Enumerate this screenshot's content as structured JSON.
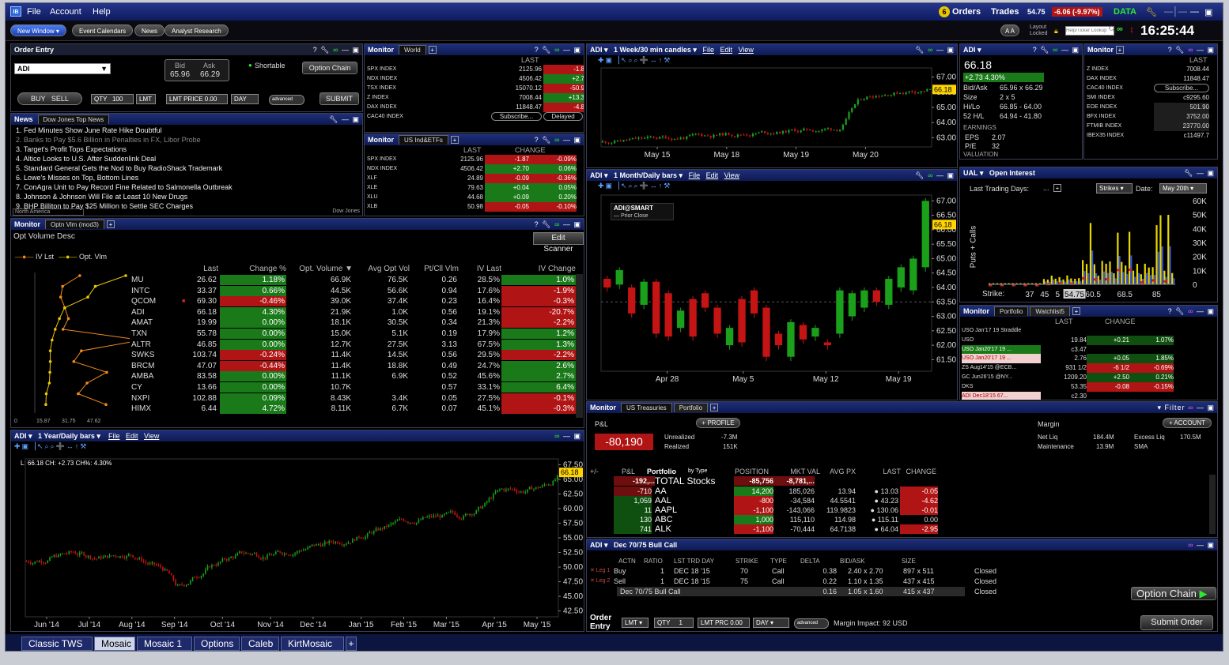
{
  "menubar": {
    "logo": "IB",
    "items": [
      "File",
      "Account",
      "Help"
    ],
    "orders_count": "6",
    "orders": "Orders",
    "trades": "Trades",
    "pnl_value": "54.75",
    "pnl_change": "-6.06 (-9.97%)",
    "data_label": "DATA"
  },
  "toolbar": {
    "buttons": [
      "New Window",
      "Event Calendars",
      "News",
      "Analyst Research"
    ],
    "aa": "A A",
    "layout_locked": "Layout Locked",
    "lookup_placeholder": "Help/Ticker Lookup",
    "clock": "16:25:44"
  },
  "order_entry": {
    "title": "Order Entry",
    "symbol": "ADI",
    "bid_label": "Bid",
    "bid": "65.96",
    "ask_label": "Ask",
    "ask": "66.29",
    "shortable": "Shortable",
    "option_chain": "Option Chain",
    "buy": "BUY",
    "sell": "SELL",
    "qty_label": "QTY",
    "qty": "100",
    "type": "LMT",
    "lmt_price": "LMT PRICE 0.00",
    "tif": "DAY",
    "advanced": "advanced",
    "submit": "SUBMIT"
  },
  "news": {
    "title": "News",
    "tab": "Dow Jones Top News",
    "items": [
      "1.  Fed Minutes Show June Rate Hike Doubtful",
      "2.  Banks to Pay $5.6 Billion in Penalties in FX, Libor Probe",
      "3.  Target's Profit Tops Expectations",
      "4.  Altice Looks to U.S. After Suddenlink  Deal",
      "5.  Standard General Gets the Nod to Buy RadioShack  Trademark",
      "6.  Lowe's  Misses on Top, Bottom Lines",
      "7.  ConAgra  Unit to Pay Record Fine Related to Salmonella Outbreak",
      "8.  Johnson & Johnson  Will File at Least 10 New Drugs",
      "9.  BHP Billiton  to Pay $25 Million to Settle SEC Charges"
    ],
    "region": "North America",
    "source": "Dow Jones"
  },
  "monitor_world": {
    "title": "Monitor",
    "tab": "World",
    "col_last": "LAST",
    "rows": [
      {
        "sym": "SPX INDEX",
        "last": "2125.96",
        "chg": "-1.8",
        "c": "red"
      },
      {
        "sym": "NDX INDEX",
        "last": "4506.42",
        "chg": "+2.7",
        "c": "green"
      },
      {
        "sym": "TSX INDEX",
        "last": "15070.12",
        "chg": "-50.9",
        "c": "red"
      },
      {
        "sym": "Z INDEX",
        "last": "7008.44",
        "chg": "+13.3",
        "c": "green"
      },
      {
        "sym": "DAX INDEX",
        "last": "11848.47",
        "chg": "-4.8",
        "c": "red"
      },
      {
        "sym": "CAC40 INDEX",
        "last": "Subscribe...",
        "chg": "Delayed",
        "c": "btn"
      }
    ]
  },
  "monitor_us": {
    "title": "Monitor",
    "tab": "US Ind&ETFs",
    "col_last": "LAST",
    "col_change": "CHANGE",
    "rows": [
      {
        "sym": "SPX INDEX",
        "last": "2125.96",
        "chg": "-1.87",
        "pct": "-0.09%",
        "c": "red"
      },
      {
        "sym": "NDX INDEX",
        "last": "4506.42",
        "chg": "+2.70",
        "pct": "0.06%",
        "c": "green"
      },
      {
        "sym": "XLF",
        "last": "24.89",
        "chg": "-0.09",
        "pct": "-0.36%",
        "c": "red"
      },
      {
        "sym": "XLE",
        "last": "79.63",
        "chg": "+0.04",
        "pct": "0.05%",
        "c": "green"
      },
      {
        "sym": "XLU",
        "last": "44.68",
        "chg": "+0.09",
        "pct": "0.20%",
        "c": "green"
      },
      {
        "sym": "XLB",
        "last": "50.98",
        "chg": "-0.05",
        "pct": "-0.10%",
        "c": "red"
      }
    ]
  },
  "scanner": {
    "title": "Monitor",
    "tab": "Optn Vlm (mod3)",
    "subtitle": "Opt Volume Desc",
    "edit_scanner": "Edit Scanner",
    "legend_a": "IV Lst",
    "legend_b": "Opt. Vlm",
    "axis_labels": [
      "0",
      "15.87",
      "31.75",
      "47.62"
    ],
    "columns": [
      "Last",
      "Change %",
      "Opt. Volume",
      "Avg Opt Vol",
      "Pt/Cll Vlm",
      "IV Last",
      "IV Change"
    ],
    "rows": [
      {
        "sym": "MU",
        "last": "26.62",
        "chg": "1.18%",
        "vol": "66.9K",
        "avg": "76.5K",
        "pc": "0.26",
        "iv": "28.5%",
        "ivc": "1.0%",
        "cc": "green",
        "ic": "green"
      },
      {
        "sym": "INTC",
        "last": "33.37",
        "chg": "0.66%",
        "vol": "44.5K",
        "avg": "56.6K",
        "pc": "0.94",
        "iv": "17.6%",
        "ivc": "-1.9%",
        "cc": "green",
        "ic": "red"
      },
      {
        "sym": "QCOM",
        "last": "69.30",
        "chg": "-0.46%",
        "vol": "39.0K",
        "avg": "37.4K",
        "pc": "0.23",
        "iv": "16.4%",
        "ivc": "-0.3%",
        "cc": "red",
        "ic": "red"
      },
      {
        "sym": "ADI",
        "last": "66.18",
        "chg": "4.30%",
        "vol": "21.9K",
        "avg": "1.0K",
        "pc": "0.56",
        "iv": "19.1%",
        "ivc": "-20.7%",
        "cc": "green",
        "ic": "red"
      },
      {
        "sym": "AMAT",
        "last": "19.99",
        "chg": "0.00%",
        "vol": "18.1K",
        "avg": "30.5K",
        "pc": "0.34",
        "iv": "21.3%",
        "ivc": "-2.2%",
        "cc": "green",
        "ic": "red"
      },
      {
        "sym": "TXN",
        "last": "55.78",
        "chg": "0.00%",
        "vol": "15.0K",
        "avg": "5.1K",
        "pc": "0.19",
        "iv": "17.9%",
        "ivc": "1.2%",
        "cc": "green",
        "ic": "green"
      },
      {
        "sym": "ALTR",
        "last": "46.85",
        "chg": "0.00%",
        "vol": "12.7K",
        "avg": "27.5K",
        "pc": "3.13",
        "iv": "67.5%",
        "ivc": "1.3%",
        "cc": "green",
        "ic": "green"
      },
      {
        "sym": "SWKS",
        "last": "103.74",
        "chg": "-0.24%",
        "vol": "11.4K",
        "avg": "14.5K",
        "pc": "0.56",
        "iv": "29.5%",
        "ivc": "-2.2%",
        "cc": "red",
        "ic": "red"
      },
      {
        "sym": "BRCM",
        "last": "47.07",
        "chg": "-0.44%",
        "vol": "11.4K",
        "avg": "18.8K",
        "pc": "0.49",
        "iv": "24.7%",
        "ivc": "2.6%",
        "cc": "red",
        "ic": "green"
      },
      {
        "sym": "AMBA",
        "last": "83.58",
        "chg": "0.00%",
        "vol": "11.1K",
        "avg": "6.9K",
        "pc": "0.52",
        "iv": "45.6%",
        "ivc": "2.7%",
        "cc": "green",
        "ic": "green"
      },
      {
        "sym": "CY",
        "last": "13.66",
        "chg": "0.00%",
        "vol": "10.7K",
        "avg": "",
        "pc": "0.57",
        "iv": "33.1%",
        "ivc": "6.4%",
        "cc": "green",
        "ic": "green"
      },
      {
        "sym": "NXPI",
        "last": "102.88",
        "chg": "0.09%",
        "vol": "8.43K",
        "avg": "3.4K",
        "pc": "0.05",
        "iv": "27.5%",
        "ivc": "-0.1%",
        "cc": "green",
        "ic": "red"
      },
      {
        "sym": "HIMX",
        "last": "6.44",
        "chg": "4.72%",
        "vol": "8.11K",
        "avg": "6.7K",
        "pc": "0.07",
        "iv": "45.1%",
        "ivc": "-0.3%",
        "cc": "green",
        "ic": "red"
      }
    ]
  },
  "chart_week": {
    "title": "ADI",
    "period": "1 Week/30 min candles",
    "menu": [
      "File",
      "Edit",
      "View"
    ],
    "y_ticks": [
      "67.00",
      "66.00",
      "65.00",
      "64.00",
      "63.00"
    ],
    "x_ticks": [
      "May 15",
      "May 18",
      "May 19",
      "May 20"
    ],
    "last": "66.18"
  },
  "chart_month": {
    "title": "ADI",
    "period": "1 Month/Daily bars",
    "menu": [
      "File",
      "Edit",
      "View"
    ],
    "legend_title": "ADI@SMART",
    "legend_sub": "Prior Close",
    "y_ticks": [
      "67.00",
      "66.50",
      "66.00",
      "65.50",
      "65.00",
      "64.50",
      "64.00",
      "63.50",
      "63.00",
      "62.50",
      "62.00",
      "61.50"
    ],
    "x_ticks": [
      "Apr 28",
      "May 5",
      "May 12",
      "May 19"
    ],
    "last": "66.18"
  },
  "chart_year": {
    "title": "ADI",
    "period": "1 Year/Daily bars",
    "menu": [
      "File",
      "Edit",
      "View"
    ],
    "info": "L: 66.18 CH: +2.73 CH%: 4.30%",
    "y_ticks": [
      "67.50",
      "65.00",
      "62.50",
      "60.00",
      "57.50",
      "55.00",
      "52.50",
      "50.00",
      "47.50",
      "45.00",
      "42.50"
    ],
    "x_ticks": [
      "Jun '14",
      "Jul '14",
      "Aug '14",
      "Sep '14",
      "Oct '14",
      "Nov '14",
      "Dec '14",
      "Jan '15",
      "Feb '15",
      "Mar '15",
      "Apr '15",
      "May '15"
    ],
    "last": "66.18"
  },
  "quote": {
    "title": "ADI",
    "price": "66.18",
    "change": "+2.73  4.30%",
    "fields": [
      {
        "k": "Bid/Ask",
        "v": "65.96 x 66.29"
      },
      {
        "k": "Size",
        "v": "2 x 5"
      },
      {
        "k": "Hi/Lo",
        "v": "66.85 - 64.00"
      },
      {
        "k": "52 H/L",
        "v": "64.94 - 41.80"
      }
    ],
    "earnings": "EARNINGS",
    "eps_k": "EPS",
    "eps": "2.07",
    "pe_k": "P/E",
    "pe": "32",
    "valuation": "VALUATION"
  },
  "monitor_right": {
    "title": "Monitor",
    "col_last": "LAST",
    "rows": [
      {
        "sym": "Z INDEX",
        "last": "7008.44"
      },
      {
        "sym": "DAX INDEX",
        "last": "11848.47"
      },
      {
        "sym": "CAC40 INDEX",
        "last": "Subscribe..."
      },
      {
        "sym": "SMI INDEX",
        "last": "c9295.60"
      },
      {
        "sym": "EOE INDEX",
        "last": "501.90"
      },
      {
        "sym": "BFX INDEX",
        "last": "3752.00"
      },
      {
        "sym": "FTMIB INDEX",
        "last": "23770.00"
      },
      {
        "sym": "IBEX35 INDEX",
        "last": "c11497.7"
      }
    ]
  },
  "open_interest": {
    "title": "UAL",
    "subtitle": "Open Interest",
    "last_trading_days": "Last Trading Days:",
    "strikes": "Strikes",
    "date_label": "Date:",
    "date": "May 20th",
    "y_label": "Puts + Calls",
    "strike_label": "Strike:",
    "y_ticks": [
      "60K",
      "50K",
      "40K",
      "30K",
      "20K",
      "10K",
      "0"
    ]
  },
  "watchlist": {
    "title": "Monitor",
    "tabs": [
      "Portfolio",
      "Watchlist5"
    ],
    "col_last": "LAST",
    "col_change": "CHANGE",
    "rows": [
      {
        "sym": "USO Jan'17 19 Straddle",
        "last": "",
        "chg": "",
        "pct": "",
        "c": ""
      },
      {
        "sym": "USO",
        "last": "19.84",
        "chg": "+0.21",
        "pct": "1.07%",
        "c": "green"
      },
      {
        "sym": "USO Jan20'17 19 ...",
        "last": "c3.47",
        "chg": "",
        "pct": "",
        "c": ""
      },
      {
        "sym": "USO Jan20'17 19 ...",
        "last": "2.76",
        "chg": "+0.05",
        "pct": "1.85%",
        "c": "green"
      },
      {
        "sym": "ZS Aug14'15 @ECB...",
        "last": "931 1/2",
        "chg": "-6 1/2",
        "pct": "-0.69%",
        "c": "red"
      },
      {
        "sym": "GC Jun26'15 @NY...",
        "last": "1209.20",
        "chg": "+2.50",
        "pct": "0.21%",
        "c": "green"
      },
      {
        "sym": "DKS",
        "last": "53.35",
        "chg": "-0.08",
        "pct": "-0.15%",
        "c": "red"
      },
      {
        "sym": "ADI Dec18'15 67...",
        "last": "c2.30",
        "chg": "",
        "pct": "",
        "c": ""
      }
    ]
  },
  "portfolio": {
    "title": "Monitor",
    "tabs": [
      "US Treasuries",
      "Portfolio"
    ],
    "filter": "Filter",
    "pnl_label": "P&L",
    "profile": "PROFILE",
    "pnl_value": "-80,190",
    "unrealized_k": "Unrealized",
    "unrealized": "-7.3M",
    "realized_k": "Realized",
    "realized": "151K",
    "margin_label": "Margin",
    "account": "ACCOUNT",
    "netliq_k": "Net Liq",
    "netliq": "184.4M",
    "excessliq_k": "Excess Liq",
    "excessliq": "170.5M",
    "maint_k": "Maintenance",
    "maint": "13.9M",
    "sma_k": "SMA",
    "columns": [
      "+/-",
      "P&L",
      "Portfolio",
      "by Type",
      "POSITION",
      "MKT VAL",
      "AVG PX",
      "LAST",
      "CHANGE"
    ],
    "total": {
      "pnl": "-192,...",
      "name": "TOTAL Stocks",
      "pos": "-85,756",
      "mkt": "-8,781,..."
    },
    "rows": [
      {
        "pnl": "-710",
        "sym": "AA",
        "pos": "14,200",
        "mkt": "185,026",
        "avg": "13.94",
        "last": "13.03",
        "chg": "-0.05",
        "pc": "red"
      },
      {
        "pnl": "1,059",
        "sym": "AAL",
        "pos": "-800",
        "mkt": "-34,584",
        "avg": "44.5541",
        "last": "43.23",
        "chg": "-4.62",
        "pc": "red"
      },
      {
        "pnl": "11",
        "sym": "AAPL",
        "pos": "-1,100",
        "mkt": "-143,066",
        "avg": "119.9823",
        "last": "130.06",
        "chg": "-0.01",
        "pc": "red"
      },
      {
        "pnl": "130",
        "sym": "ABC",
        "pos": "1,000",
        "mkt": "115,110",
        "avg": "114.98",
        "last": "115.11",
        "chg": "0.00",
        "pc": ""
      },
      {
        "pnl": "741",
        "sym": "ALK",
        "pos": "-1,100",
        "mkt": "-70,444",
        "avg": "64.7138",
        "last": "64.04",
        "chg": "-2.95",
        "pc": "red"
      }
    ]
  },
  "combo": {
    "title": "ADI",
    "subtitle": "Dec 70/75 Bull Call",
    "columns": [
      "ACTN",
      "RATIO",
      "LST TRD DAY",
      "STRIKE",
      "TYPE",
      "DELTA",
      "BID/ASK",
      "SIZE"
    ],
    "rows": [
      {
        "leg": "Leg 1",
        "actn": "Buy",
        "ratio": "1",
        "day": "DEC 18 '15",
        "strike": "70",
        "type": "Call",
        "delta": "0.38",
        "bidask": "2.40 x 2.70",
        "size": "897 x 511",
        "status": "Closed"
      },
      {
        "leg": "Leg 2",
        "actn": "Sell",
        "ratio": "1",
        "day": "DEC 18 '15",
        "strike": "75",
        "type": "Call",
        "delta": "0.22",
        "bidask": "1.10 x 1.35",
        "size": "437 x 415",
        "status": "Closed"
      }
    ],
    "total": {
      "name": "Dec 70/75 Bull Call",
      "delta": "0.16",
      "bidask": "1.05 x 1.60",
      "size": "415 x 437",
      "status": "Closed"
    },
    "option_chain": "Option Chain",
    "order_label": "Order Entry",
    "type": "LMT",
    "qty_label": "QTY",
    "qty": "1",
    "lmt_prc": "LMT PRC 0.00",
    "tif": "DAY",
    "advanced": "advanced",
    "margin_impact": "Margin Impact: 92 USD",
    "submit": "Submit Order"
  },
  "bottom_tabs": [
    "Classic TWS",
    "Mosaic",
    "Mosaic 1",
    "Options",
    "Caleb",
    "KirtMosaic"
  ],
  "active_tab": "Mosaic",
  "colors": {
    "up": "#1aa01a",
    "down": "#c41414",
    "header": "#1e2f7a",
    "last_tag": "#ffd400"
  }
}
